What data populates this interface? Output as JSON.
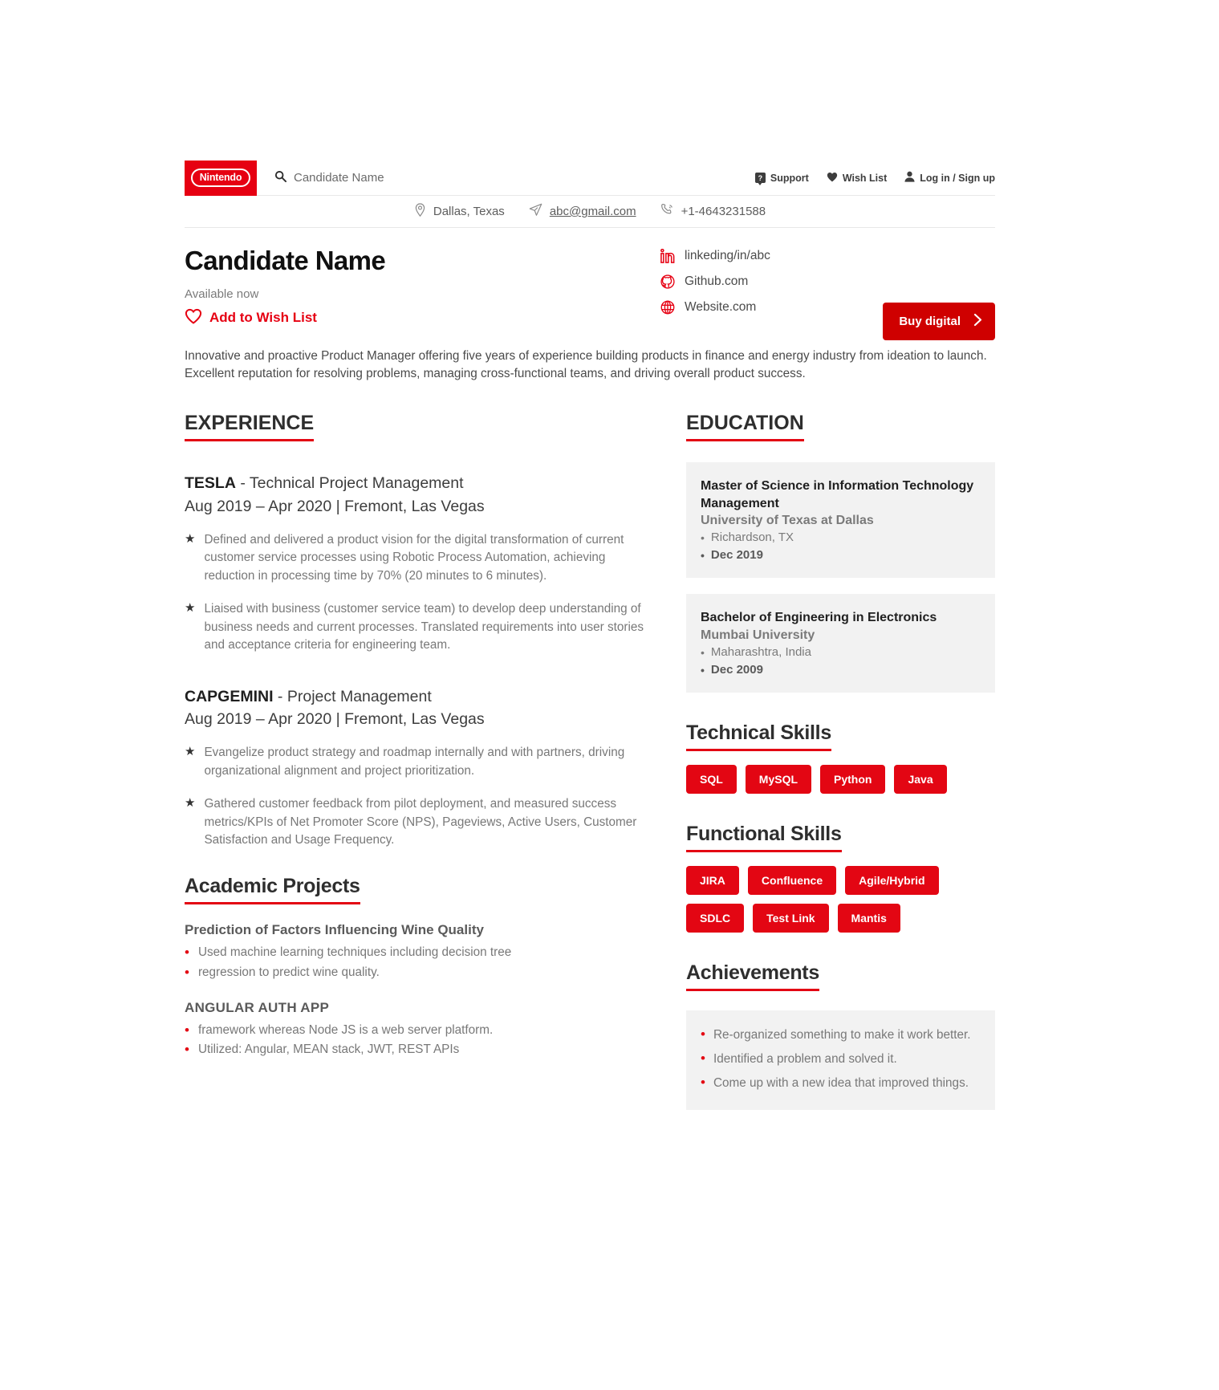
{
  "brand": {
    "logo_text": "Nintendo",
    "accent": "#e60012",
    "tag_red": "#e30613"
  },
  "topnav": {
    "search_placeholder": "Candidate Name",
    "support_label": "Support",
    "support_icon_char": "?",
    "wishlist_label": "Wish List",
    "account_label": "Log in / Sign up"
  },
  "contact": {
    "location": "Dallas, Texas",
    "email": "abc@gmail.com",
    "phone": "+1-4643231588"
  },
  "hero": {
    "name": "Candidate Name",
    "availability": "Available now",
    "wishlist_cta": "Add to Wish List",
    "buy_label": "Buy digital",
    "buy_chevron": "›",
    "links": [
      {
        "icon": "linkedin-icon",
        "label": "linkeding/in/abc"
      },
      {
        "icon": "github-icon",
        "label": "Github.com"
      },
      {
        "icon": "globe-icon",
        "label": "Website.com"
      }
    ],
    "summary": "Innovative and proactive Product Manager offering five years of experience building products in finance and energy industry from ideation to launch. Excellent reputation for resolving problems, managing cross-functional teams, and driving overall product success."
  },
  "experience": {
    "heading": "EXPERIENCE",
    "jobs": [
      {
        "company": "TESLA",
        "role": " - Technical Project Management",
        "meta": "Aug 2019 – Apr 2020 | Fremont, Las Vegas",
        "bullets": [
          "Defined and delivered a product vision for the digital transformation of current customer service processes using Robotic Process Automation, achieving reduction in processing time by 70% (20 minutes to 6 minutes).",
          "Liaised with business (customer service team) to develop deep understanding of business needs and current processes. Translated requirements into user stories and acceptance criteria for engineering team."
        ]
      },
      {
        "company": "CAPGEMINI",
        "role": " - Project Management",
        "meta": "Aug 2019 – Apr 2020 | Fremont, Las Vegas",
        "bullets": [
          "Evangelize product strategy and roadmap internally and with partners, driving organizational alignment and project prioritization.",
          "Gathered customer feedback from pilot deployment, and measured success metrics/KPIs of Net Promoter Score (NPS), Pageviews, Active Users, Customer Satisfaction and Usage Frequency."
        ]
      }
    ]
  },
  "projects": {
    "heading": "Academic Projects",
    "items": [
      {
        "title": "Prediction of Factors Influencing Wine Quality",
        "bullets": [
          "Used machine learning techniques including decision tree",
          "regression to predict wine quality."
        ]
      },
      {
        "title": "ANGULAR AUTH APP",
        "bullets": [
          "framework whereas Node JS is a web server platform.",
          "Utilized: Angular, MEAN stack, JWT, REST APIs"
        ]
      }
    ]
  },
  "education": {
    "heading": "EDUCATION",
    "cards": [
      {
        "degree": "Master of Science in Information Technology Management",
        "school": "University of Texas at Dallas",
        "location": "Richardson, TX",
        "date": "Dec 2019"
      },
      {
        "degree": "Bachelor of Engineering in Electronics",
        "school": "Mumbai University",
        "location": "Maharashtra, India",
        "date": "Dec 2009"
      }
    ]
  },
  "technical_skills": {
    "heading": "Technical Skills",
    "tags": [
      "SQL",
      "MySQL",
      "Python",
      "Java"
    ]
  },
  "functional_skills": {
    "heading": "Functional Skills",
    "tags": [
      "JIRA",
      "Confluence",
      "Agile/Hybrid",
      "SDLC",
      "Test Link",
      "Mantis"
    ]
  },
  "achievements": {
    "heading": "Achievements",
    "items": [
      "Re-organized something to make it work better.",
      "Identified a problem and solved it.",
      "Come up with a new idea that improved things."
    ]
  }
}
